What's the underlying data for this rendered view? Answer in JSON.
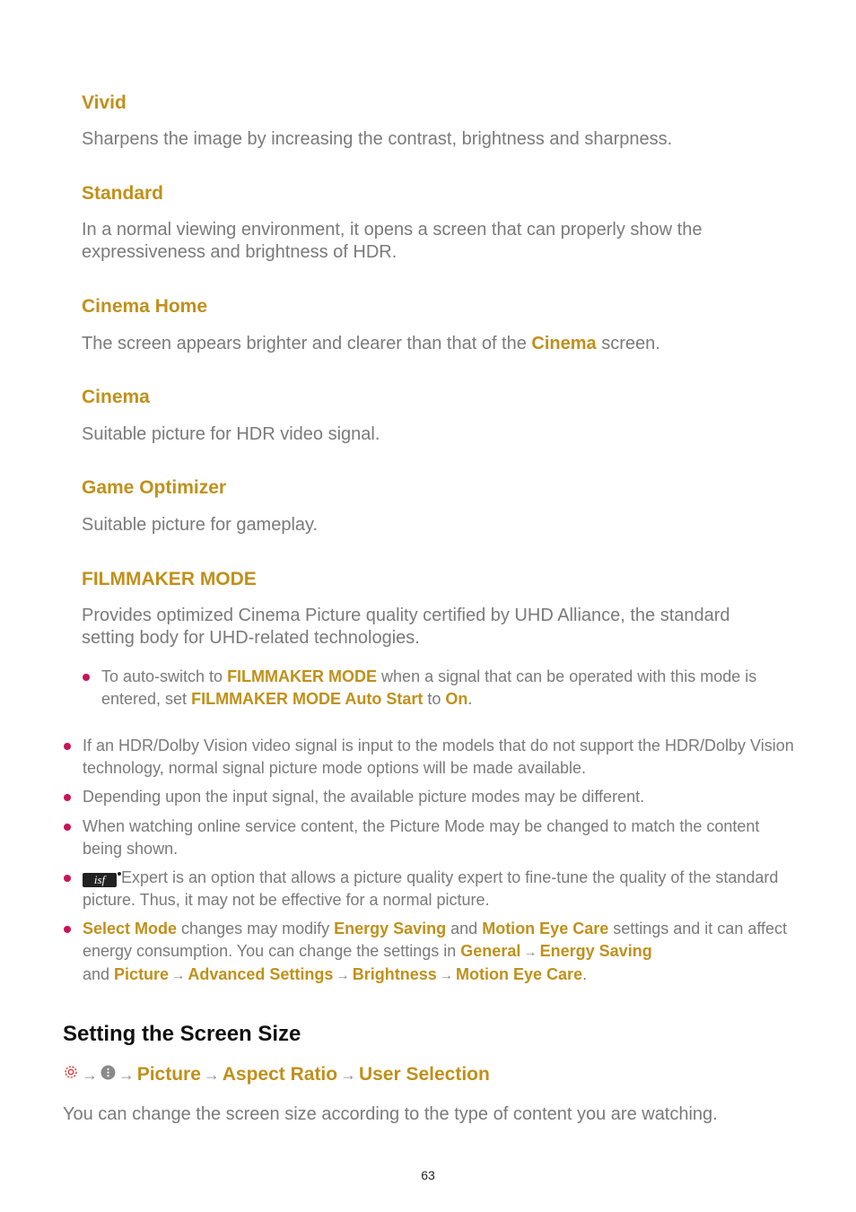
{
  "modes": [
    {
      "title": "Vivid",
      "desc": "Sharpens the image by increasing the contrast, brightness and sharpness."
    },
    {
      "title": "Standard",
      "desc": "In a normal viewing environment, it opens a screen that can properly show the expressiveness and brightness of HDR."
    },
    {
      "title": "Cinema Home",
      "desc_pre": "The screen appears brighter and clearer than that of the ",
      "desc_link": "Cinema",
      "desc_post": " screen."
    },
    {
      "title": "Cinema",
      "desc": "Suitable picture for HDR video signal."
    },
    {
      "title": "Game Optimizer",
      "desc": "Suitable picture for gameplay."
    },
    {
      "title": "FILMMAKER MODE",
      "desc": "Provides optimized Cinema Picture quality certified by UHD Alliance, the standard setting body for UHD-related technologies."
    }
  ],
  "filmmaker_note": {
    "t1": "To auto-switch to ",
    "b1": "FILMMAKER MODE",
    "t2": " when a signal that can be operated with this mode is entered, set ",
    "b2": "FILMMAKER MODE Auto Start",
    "t3": " to ",
    "b3": "On",
    "t4": "."
  },
  "notes": {
    "n1": "If an HDR/Dolby Vision video signal is input to the models that do not support the HDR/Dolby Vision technology, normal signal picture mode options will be made available.",
    "n2": "Depending upon the input signal, the available picture modes may be different.",
    "n3": "When watching online service content, the Picture Mode may be changed to match the content being shown.",
    "n4_icon": "isf",
    "n4": " Expert is an option that allows a picture quality expert to fine-tune the quality of the standard picture. Thus, it may not be effective for a normal picture.",
    "n5": {
      "b1": "Select Mode",
      "t1": " changes may modify ",
      "b2": "Energy Saving",
      "t2": " and ",
      "b3": "Motion Eye Care",
      "t3": " settings and it can affect energy consumption. You can change the settings in ",
      "b4": "General",
      "b5": "Energy Saving",
      "t4": " and ",
      "b6": "Picture",
      "b7": "Advanced Settings",
      "b8": "Brightness",
      "b9": "Motion Eye Care",
      "t5": "."
    }
  },
  "section": {
    "title": "Setting the Screen Size",
    "path": [
      "Picture",
      "Aspect Ratio",
      "User Selection"
    ],
    "arrow": "→",
    "intro": "You can change the screen size according to the type of content you are watching."
  },
  "page_number": "63"
}
